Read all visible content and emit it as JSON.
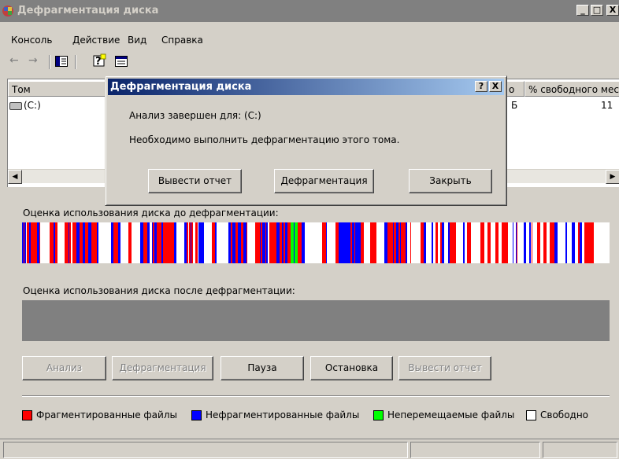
{
  "window": {
    "title": "Дефрагментация диска",
    "min_glyph": "_",
    "max_glyph": "□",
    "close_glyph": "X"
  },
  "menu": [
    "Консоль",
    "Действие",
    "Вид",
    "Справка"
  ],
  "toolbar": {
    "icons": [
      "back-icon",
      "forward-icon",
      "show-hide-tree-icon",
      "help-icon",
      "properties-icon"
    ]
  },
  "volume_list": {
    "columns": [
      "Том",
      "о",
      "% свободного мес"
    ],
    "rows": [
      {
        "volume": "(C:)",
        "free_partial": "Б",
        "percent_free_partial": "11"
      }
    ]
  },
  "analysis": {
    "before_label": "Оценка использования диска до дефрагментации:",
    "after_label": "Оценка использования диска после дефрагментации:"
  },
  "buttons": {
    "analyze": "Анализ",
    "defragment": "Дефрагментация",
    "pause": "Пауза",
    "stop": "Остановка",
    "view_report": "Вывести отчет"
  },
  "legend": {
    "fragmented": "Фрагментированные файлы",
    "contiguous": "Нефрагментированные файлы",
    "unmovable": "Неперемещаемые файлы",
    "free": "Свободно"
  },
  "colors": {
    "fragmented": "#ff0000",
    "contiguous": "#0000ff",
    "unmovable": "#00ff00",
    "free": "#ffffff"
  },
  "dialog": {
    "title": "Дефрагментация диска",
    "help_glyph": "?",
    "close_glyph": "X",
    "line1": "Анализ завершен для: (C:)",
    "line2": "Необходимо выполнить дефрагментацию этого тома.",
    "btn_report": "Вывести отчет",
    "btn_defrag": "Дефрагментация",
    "btn_close": "Закрыть"
  }
}
